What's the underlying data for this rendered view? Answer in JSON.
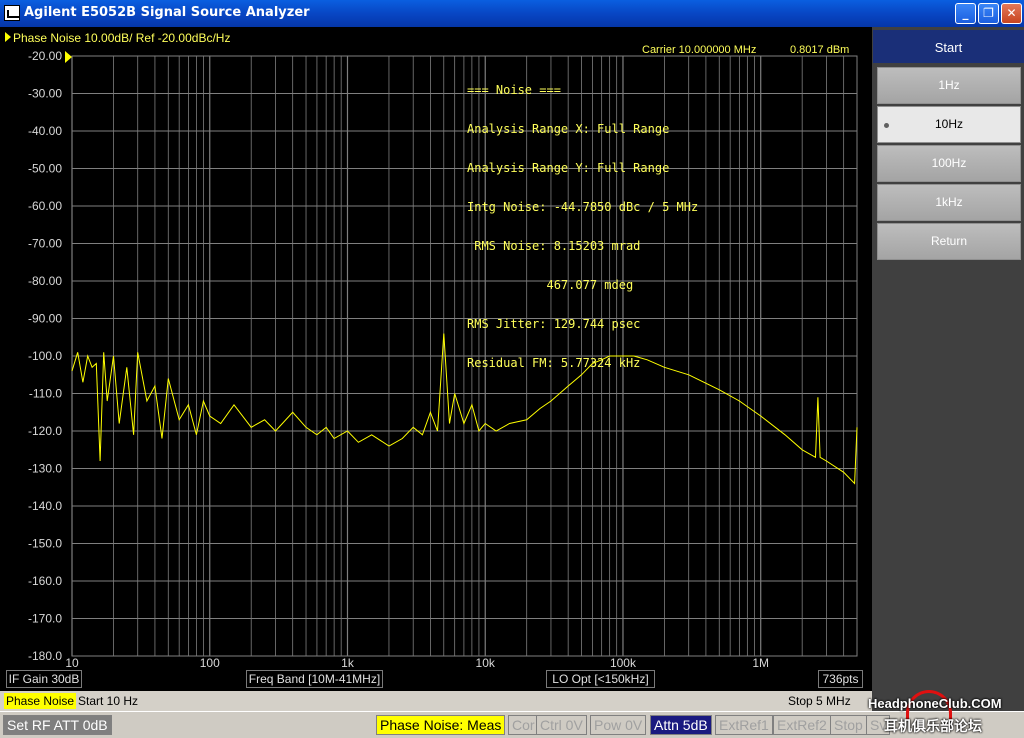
{
  "window": {
    "title": "Agilent E5052B Signal Source Analyzer",
    "minimize_glyph": "_",
    "maximize_glyph": "❐",
    "close_glyph": "✕"
  },
  "trace_header": "Phase Noise 10.00dB/ Ref -20.00dBc/Hz",
  "carrier": {
    "frequency": "Carrier 10.000000 MHz",
    "power": "0.8017 dBm"
  },
  "noise_panel": [
    "=== Noise ===",
    "Analysis Range X: Full Range",
    "Analysis Range Y: Full Range",
    "Intg Noise: -44.7850 dBc / 5 MHz",
    " RMS Noise: 8.15203 mrad",
    "           467.077 mdeg",
    "RMS Jitter: 129.744 psec",
    "Residual FM: 5.77324 kHz"
  ],
  "status_row1": {
    "if_gain": "IF Gain 30dB",
    "freq_band": "Freq Band [10M-41MHz]",
    "lo_opt": "LO Opt [<150kHz]",
    "points": "736pts"
  },
  "sweep": {
    "measurement": "Phase Noise",
    "start": "Start 10 Hz",
    "stop": "Stop 5 MHz"
  },
  "status_row3": {
    "set_rf": "Set RF ATT 0dB",
    "mode": "Phase Noise: Meas",
    "cor": "Cor",
    "ctrl": "Ctrl  0V",
    "pow": "Pow  0V",
    "attn": "Attn 5dB",
    "extref1": "ExtRef1",
    "extref2": "ExtRef2",
    "stop": "Stop",
    "sv": "Sv"
  },
  "softkeys": {
    "header": "Start",
    "items": [
      "1Hz",
      "10Hz",
      "100Hz",
      "1kHz",
      "Return"
    ],
    "selected_index": 1
  },
  "watermark": {
    "line1": "HeadphoneClub.COM",
    "line2": "耳机俱乐部论坛"
  },
  "colors": {
    "trace": "#ffff00",
    "grid": "#7f7f7f",
    "text": "#ffff5a",
    "softkey_header": "#1a2f78"
  },
  "chart_data": {
    "type": "line",
    "title": "Phase Noise 10.00dB/ Ref -20.00dBc/Hz",
    "xlabel": "",
    "ylabel": "",
    "xscale": "log",
    "xlim": [
      10,
      5000000
    ],
    "ylim": [
      -180,
      -20
    ],
    "yticks": [
      "-20.00",
      "-30.00",
      "-40.00",
      "-50.00",
      "-60.00",
      "-70.00",
      "-80.00",
      "-90.00",
      "-100.0",
      "-110.0",
      "-120.0",
      "-130.0",
      "-140.0",
      "-150.0",
      "-160.0",
      "-170.0",
      "-180.0"
    ],
    "ytick_values": [
      -20,
      -30,
      -40,
      -50,
      -60,
      -70,
      -80,
      -90,
      -100,
      -110,
      -120,
      -130,
      -140,
      -150,
      -160,
      -170,
      -180
    ],
    "xtick_labels": [
      "10",
      "100",
      "1k",
      "10k",
      "100k",
      "1M"
    ],
    "xtick_values": [
      10,
      100,
      1000,
      10000,
      100000,
      1000000
    ],
    "grid": true,
    "series": [
      {
        "x": [
          10,
          11,
          12,
          13,
          14,
          15,
          16,
          17,
          18,
          20,
          22,
          25,
          28,
          30,
          35,
          40,
          45,
          50,
          60,
          70,
          80,
          90,
          100,
          120,
          150,
          200,
          250,
          300,
          400,
          500,
          600,
          700,
          800,
          1000,
          1200,
          1500,
          2000,
          2500,
          3000,
          3500,
          4000,
          4500,
          5000,
          5500,
          6000,
          7000,
          8000,
          9000,
          10000,
          12000,
          15000,
          20000,
          25000,
          30000,
          40000,
          50000,
          60000,
          70000,
          80000,
          90000,
          100000,
          120000,
          150000,
          200000,
          300000,
          500000,
          700000,
          1000000,
          1500000,
          2000000,
          2500000,
          2600000,
          2700000,
          3000000,
          4000000,
          4800000,
          5000000
        ],
        "y": [
          -104,
          -99,
          -107,
          -100,
          -103,
          -102,
          -128,
          -99,
          -112,
          -100,
          -118,
          -103,
          -121,
          -99,
          -112,
          -108,
          -122,
          -106,
          -117,
          -113,
          -121,
          -112,
          -116,
          -118,
          -113,
          -119,
          -117,
          -120,
          -115,
          -119,
          -121,
          -119,
          -122,
          -120,
          -123,
          -121,
          -124,
          -122,
          -119,
          -121,
          -115,
          -120,
          -94,
          -118,
          -110,
          -118,
          -113,
          -120,
          -118,
          -120,
          -118,
          -117,
          -114,
          -112,
          -108,
          -105,
          -102,
          -101,
          -100,
          -100,
          -100,
          -100,
          -101,
          -103,
          -105,
          -109,
          -112,
          -116,
          -121,
          -125,
          -127,
          -111,
          -127,
          -128,
          -131,
          -134,
          -119
        ]
      }
    ]
  }
}
